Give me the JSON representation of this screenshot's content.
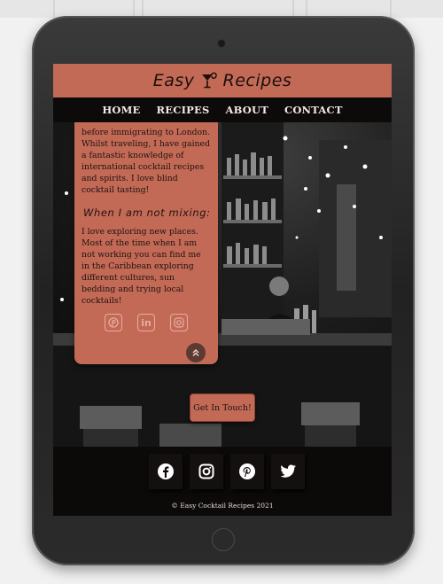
{
  "brand": {
    "name_left": "Easy",
    "name_right": "Recipes",
    "logo_icon": "cocktail-glass-icon"
  },
  "nav": {
    "items": [
      {
        "label": "HOME"
      },
      {
        "label": "RECIPES"
      },
      {
        "label": "ABOUT"
      },
      {
        "label": "CONTACT"
      }
    ]
  },
  "about": {
    "intro": "before immigrating to London. Whilst traveling, I have gained a fantastic knowledge of international cocktail recipes and spirits. I love blind cocktail tasting!",
    "heading": "When I am not mixing:",
    "body": "I love exploring new places. Most of the time when I am not working you can find me in the Caribbean exploring different cultures, sun bedding and trying local cocktails!",
    "social_icons": [
      "pinterest-icon",
      "linkedin-icon",
      "instagram-icon"
    ],
    "back_to_top_icon": "double-chevron-up-icon"
  },
  "cta": {
    "label": "Get In Touch!"
  },
  "footer": {
    "social_icons": [
      "facebook-icon",
      "instagram-icon",
      "pinterest-icon",
      "twitter-icon"
    ],
    "copyright": "© Easy Cocktail Recipes 2021"
  },
  "colors": {
    "accent": "#c36a56",
    "nav_bg": "#0d0a0a",
    "footer_bg": "#0c0909"
  }
}
